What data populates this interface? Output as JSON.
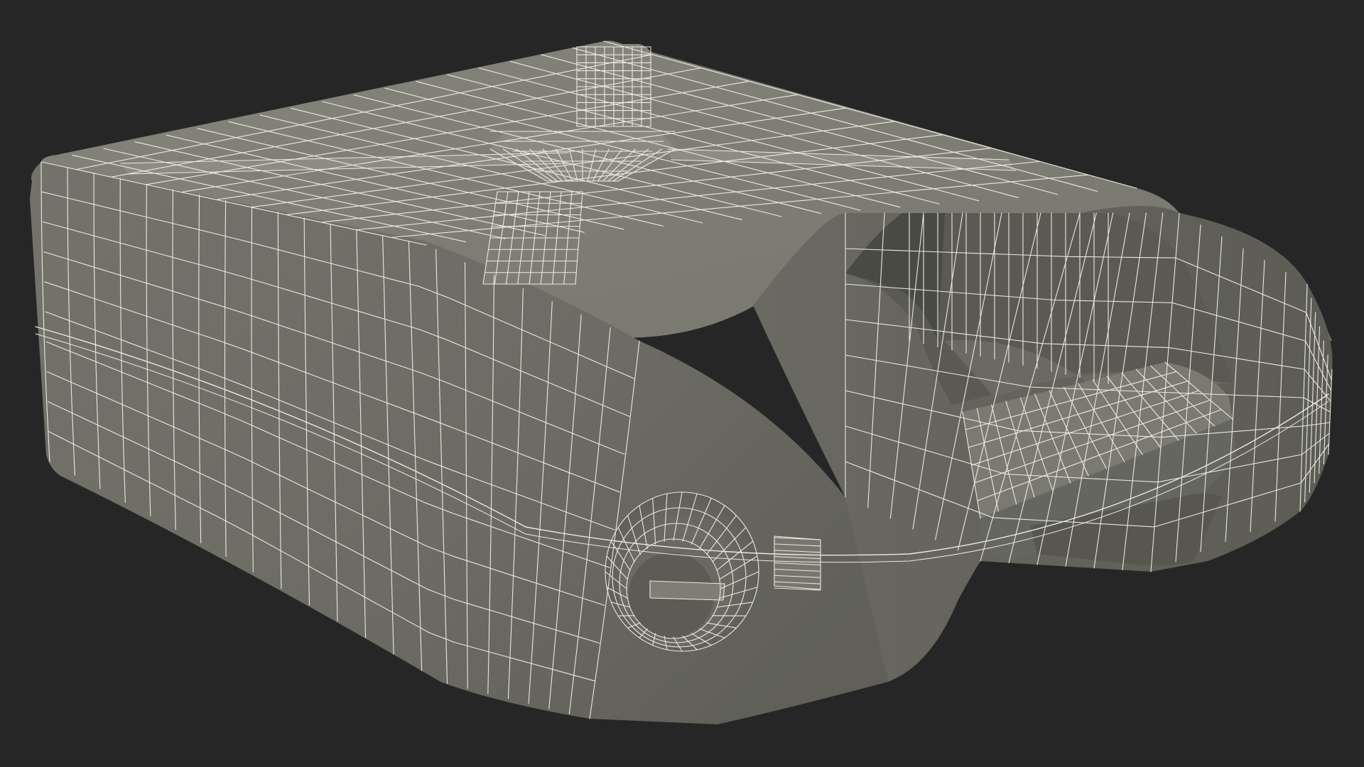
{
  "scene": {
    "subject": "jerrycan-wireframe-render",
    "colors": {
      "background": "#262626",
      "body_top": "#7d7d72",
      "body_front": "#6f6f66",
      "body_side": "#66665e",
      "body_shadow": "#55554e",
      "handle_inner": "#5e5e57",
      "handle_inner_dark": "#4a4a45",
      "cap": "#707068",
      "wire": "#f2f0e6"
    }
  }
}
